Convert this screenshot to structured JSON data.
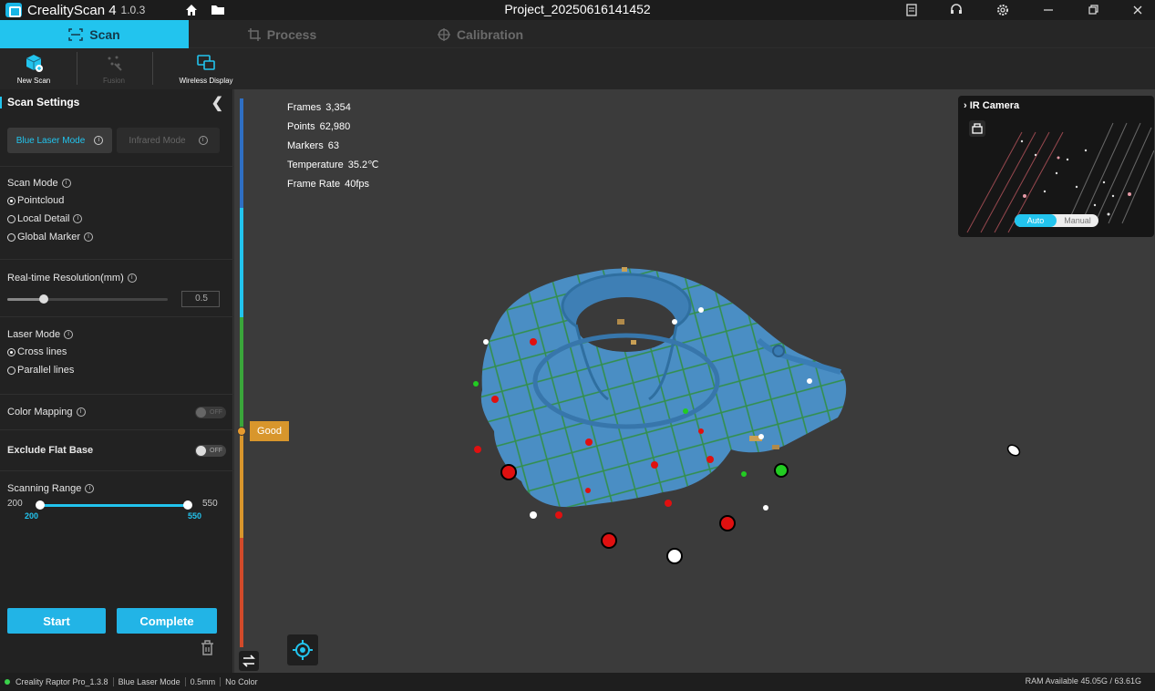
{
  "app": {
    "name": "CrealityScan 4",
    "version": "1.0.3",
    "project_title": "Project_20250616141452"
  },
  "tabs": [
    {
      "label": "Scan",
      "icon": "scan-icon",
      "active": true
    },
    {
      "label": "Process",
      "icon": "crop-icon",
      "active": false
    },
    {
      "label": "Calibration",
      "icon": "target-icon",
      "active": false
    }
  ],
  "toolbar": {
    "new_scan": "New Scan",
    "fusion": "Fusion",
    "wireless_display": "Wireless Display"
  },
  "scan_settings": {
    "title": "Scan Settings",
    "blue_laser_mode": "Blue Laser Mode",
    "infrared_mode": "Infrared Mode",
    "scan_mode_label": "Scan Mode",
    "scan_modes": [
      "Pointcloud",
      "Local Detail",
      "Global Marker"
    ],
    "scan_mode_selected": "Pointcloud",
    "resolution_label": "Real-time Resolution(mm)",
    "resolution_value": "0.5",
    "resolution_fraction": 0.23,
    "laser_mode_label": "Laser Mode",
    "laser_modes": [
      "Cross lines",
      "Parallel lines"
    ],
    "laser_mode_selected": "Cross lines",
    "color_mapping_label": "Color Mapping",
    "color_mapping_state": "OFF",
    "exclude_flat_base_label": "Exclude Flat Base",
    "exclude_flat_base_state": "OFF",
    "scanning_range_label": "Scanning Range",
    "range_min": "200",
    "range_max": "550",
    "range_low_value": "200",
    "range_high_value": "550",
    "start_label": "Start",
    "complete_label": "Complete"
  },
  "stats": {
    "frames_label": "Frames",
    "frames": "3,354",
    "points_label": "Points",
    "points": "62,980",
    "markers_label": "Markers",
    "markers": "63",
    "temperature_label": "Temperature",
    "temperature": "35.2℃",
    "frame_rate_label": "Frame Rate",
    "frame_rate": "40fps"
  },
  "quality": {
    "label": "Good",
    "level_fraction": 0.62
  },
  "ir_camera": {
    "title": "IR Camera",
    "auto": "Auto",
    "manual": "Manual"
  },
  "status": {
    "device": "Creality Raptor Pro_1.3.8",
    "mode": "Blue Laser Mode",
    "resolution": "0.5mm",
    "color": "No Color",
    "ram": "RAM Available 45.05G / 63.61G"
  },
  "colors": {
    "accent": "#22c4ee",
    "model": "#4a8ec4",
    "laser_lines": "#2f8f3a",
    "quality_good": "#d8962c"
  }
}
